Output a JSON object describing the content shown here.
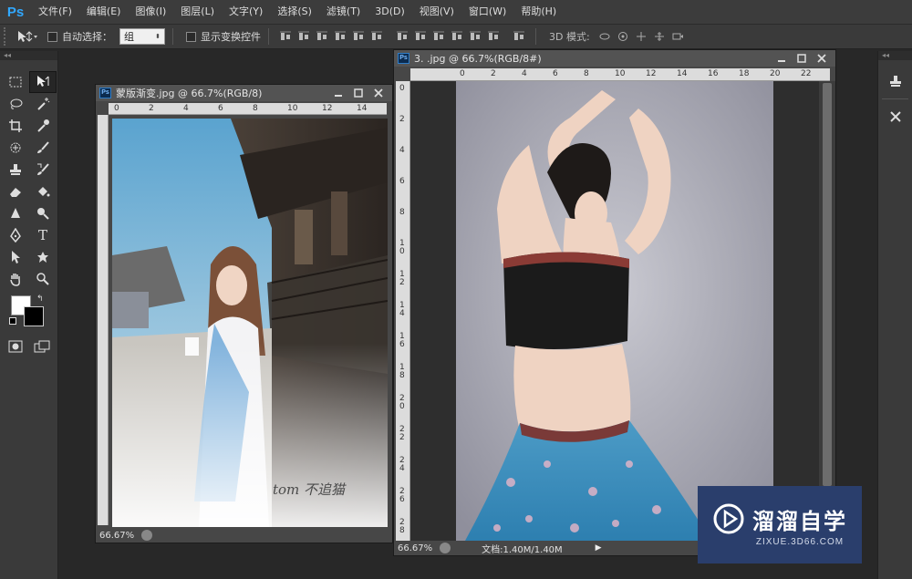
{
  "app": {
    "logo": "Ps",
    "menus": [
      "文件(F)",
      "编辑(E)",
      "图像(I)",
      "图层(L)",
      "文字(Y)",
      "选择(S)",
      "滤镜(T)",
      "3D(D)",
      "视图(V)",
      "窗口(W)",
      "帮助(H)"
    ]
  },
  "options": {
    "auto_select_label": "自动选择：",
    "auto_select_value": "组",
    "show_transform_label": "显示变换控件",
    "mode_3d_label": "3D 模式:"
  },
  "toolbar": {
    "collapse": "◂◂"
  },
  "doc1": {
    "title": "蒙版渐变.jpg @ 66.7%(RGB/8)",
    "zoom": "66.67%",
    "ruler_h": [
      "0",
      "2",
      "4",
      "6",
      "8",
      "10",
      "12",
      "14"
    ],
    "photo_signature": "tom 不追猫"
  },
  "doc2": {
    "title": "3. .jpg @ 66.7%(RGB/8#)",
    "zoom": "66.67%",
    "doc_size": "文档:1.40M/1.40M",
    "ruler_h": [
      "0",
      "2",
      "4",
      "6",
      "8",
      "10",
      "12",
      "14",
      "16",
      "18",
      "20",
      "22"
    ],
    "ruler_v": [
      "0",
      "2",
      "4",
      "6",
      "8",
      "10",
      "12",
      "14",
      "16",
      "18",
      "20",
      "22",
      "24",
      "26",
      "28"
    ]
  },
  "watermark": {
    "text": "溜溜自学",
    "sub": "ZIXUE.3D66.COM"
  }
}
